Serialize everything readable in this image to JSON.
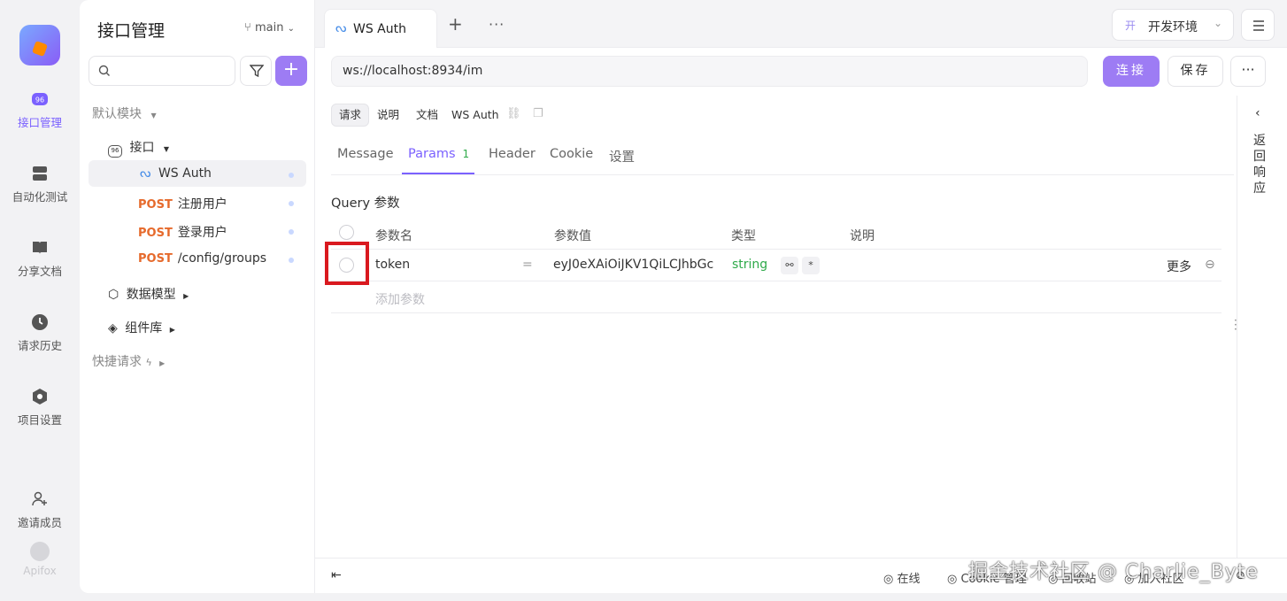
{
  "rail": {
    "items": [
      {
        "label": "接口管理",
        "icon": "api-icon"
      },
      {
        "label": "自动化测试",
        "icon": "database-icon"
      },
      {
        "label": "分享文档",
        "icon": "book-icon"
      },
      {
        "label": "请求历史",
        "icon": "clock-icon"
      },
      {
        "label": "项目设置",
        "icon": "settings-icon"
      },
      {
        "label": "邀请成员",
        "icon": "user-plus-icon"
      }
    ],
    "brand": "Apifox"
  },
  "tree": {
    "title": "接口管理",
    "branch": "main",
    "default_module": "默认模块",
    "api_group": "接口",
    "items": [
      {
        "method": "",
        "label": "WS Auth"
      },
      {
        "method": "POST",
        "label": "注册用户"
      },
      {
        "method": "POST",
        "label": "登录用户"
      },
      {
        "method": "POST",
        "label": "/config/groups"
      }
    ],
    "data_model": "数据模型",
    "components": "组件库",
    "quick_request": "快捷请求"
  },
  "tabs": {
    "active": "WS Auth",
    "plus": "+",
    "more": "···"
  },
  "env": {
    "badge": "开",
    "label": "开发环境"
  },
  "request": {
    "url": "ws://localhost:8934/im",
    "connect_label": "连接",
    "save_label": "保存",
    "more_label": "···"
  },
  "subtabs": [
    "请求",
    "说明",
    "文档"
  ],
  "crumb_name": "WS Auth",
  "param_tabs": [
    {
      "label": "Message"
    },
    {
      "label": "Params",
      "count": "1"
    },
    {
      "label": "Header"
    },
    {
      "label": "Cookie"
    },
    {
      "label": "设置"
    }
  ],
  "query": {
    "title": "Query 参数",
    "headers": [
      "参数名",
      "参数值",
      "类型",
      "说明"
    ],
    "rows": [
      {
        "name": "token",
        "eq": "=",
        "value": "eyJ0eXAiOiJKV1QiLCJhbGc",
        "type": "string",
        "more": "更多"
      }
    ],
    "add_placeholder": "添加参数"
  },
  "response": {
    "label": "返回响应"
  },
  "footer": {
    "online": "在线",
    "cookie": "Cookie 管理",
    "recycle": "回收站",
    "community": "加入社区"
  },
  "watermark": "掘金技术社区 @ Charlie_Byte",
  "colors": {
    "accent": "#9d7cf4",
    "post": "#e66a2c",
    "type_string": "#2faa4a",
    "highlight": "#d9191f"
  }
}
